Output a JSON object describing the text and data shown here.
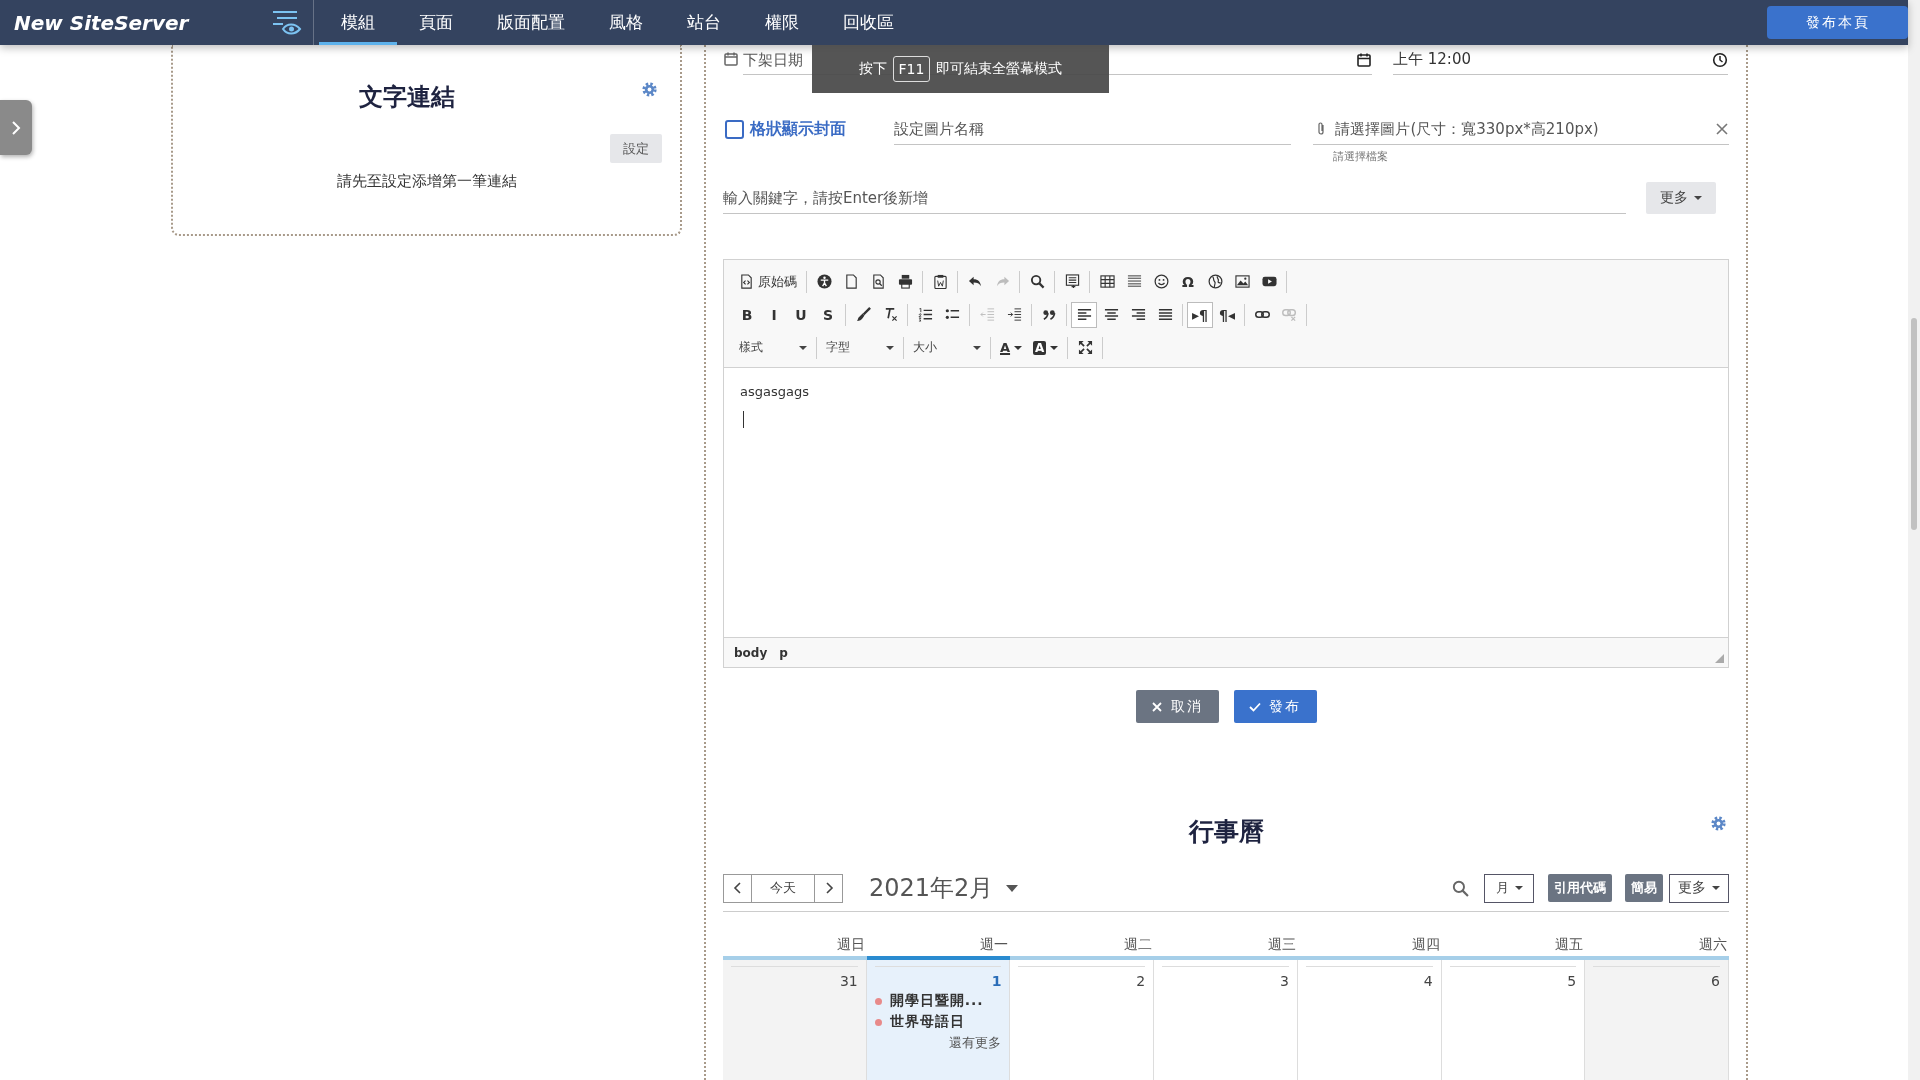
{
  "header": {
    "logo": "New SiteServer",
    "tabs": [
      {
        "label": "模組",
        "selected": true
      },
      {
        "label": "頁面",
        "selected": false
      },
      {
        "label": "版面配置",
        "selected": false
      },
      {
        "label": "風格",
        "selected": false
      },
      {
        "label": "站台",
        "selected": false
      },
      {
        "label": "權限",
        "selected": false
      },
      {
        "label": "回收區",
        "selected": false
      }
    ],
    "publish_button": "發布本頁"
  },
  "card": {
    "title": "文字連結",
    "settings_button": "設定",
    "message": "請先至設定添增第一筆連結"
  },
  "form": {
    "expire_date": {
      "placeholder": "下架日期"
    },
    "time": {
      "value": "上午 12:00"
    },
    "fullscreen_tip": {
      "before": "按下",
      "key": "F11",
      "after": "即可結束全螢幕模式"
    },
    "grid_cover": {
      "label": "格狀顯示封面",
      "checked": false
    },
    "image_name": {
      "placeholder": "設定圖片名稱"
    },
    "image_file": {
      "placeholder": "請選擇圖片(尺寸：寬330px*高210px)",
      "hint": "請選擇檔案"
    },
    "keywords": {
      "placeholder": "輸入關鍵字，請按Enter後新增"
    },
    "more_button": "更多"
  },
  "editor": {
    "rows": [
      {
        "groups": [
          {
            "items": [
              {
                "kind": "labeled",
                "label": "原始碼",
                "disabled": false,
                "active": false
              }
            ]
          },
          {
            "items": [
              {
                "kind": "icon",
                "disabled": false,
                "active": false
              },
              {
                "kind": "icon",
                "disabled": false,
                "active": false
              },
              {
                "kind": "icon",
                "disabled": false,
                "active": false
              },
              {
                "kind": "icon",
                "disabled": false,
                "active": false
              }
            ]
          },
          {
            "items": [
              {
                "kind": "icon",
                "disabled": false,
                "active": false
              }
            ]
          },
          {
            "items": [
              {
                "kind": "icon",
                "disabled": false,
                "active": false
              },
              {
                "kind": "icon",
                "disabled": true,
                "active": false
              }
            ]
          },
          {
            "items": [
              {
                "kind": "icon",
                "disabled": false,
                "active": false
              }
            ]
          },
          {
            "items": [
              {
                "kind": "icon",
                "disabled": false,
                "active": false
              }
            ]
          },
          {
            "items": [
              {
                "kind": "icon",
                "disabled": false,
                "active": false
              },
              {
                "kind": "icon",
                "disabled": false,
                "active": false
              },
              {
                "kind": "icon",
                "disabled": false,
                "active": false
              },
              {
                "kind": "glyph",
                "label": "Ω",
                "disabled": false,
                "active": false
              },
              {
                "kind": "icon",
                "disabled": false,
                "active": false
              },
              {
                "kind": "icon",
                "disabled": false,
                "active": false
              },
              {
                "kind": "icon",
                "disabled": false,
                "active": false
              }
            ]
          }
        ]
      },
      {
        "groups": [
          {
            "items": [
              {
                "kind": "glyph",
                "label": "B",
                "disabled": false,
                "active": false
              },
              {
                "kind": "glyph",
                "label": "I",
                "disabled": false,
                "active": false
              },
              {
                "kind": "glyph",
                "label": "U",
                "disabled": false,
                "active": false
              },
              {
                "kind": "glyph",
                "label": "S",
                "disabled": false,
                "active": false
              }
            ]
          },
          {
            "items": [
              {
                "kind": "icon",
                "disabled": false,
                "active": false
              },
              {
                "kind": "icon",
                "disabled": false,
                "active": false
              }
            ]
          },
          {
            "items": [
              {
                "kind": "icon",
                "disabled": false,
                "active": false
              },
              {
                "kind": "icon",
                "disabled": false,
                "active": false
              }
            ]
          },
          {
            "items": [
              {
                "kind": "icon",
                "disabled": true,
                "active": false
              },
              {
                "kind": "icon",
                "disabled": false,
                "active": false
              }
            ]
          },
          {
            "items": [
              {
                "kind": "icon",
                "disabled": false,
                "active": false
              }
            ]
          },
          {
            "items": [
              {
                "kind": "icon",
                "disabled": false,
                "active": true
              },
              {
                "kind": "icon",
                "disabled": false,
                "active": false
              },
              {
                "kind": "icon",
                "disabled": false,
                "active": false
              },
              {
                "kind": "icon",
                "disabled": false,
                "active": false
              }
            ]
          },
          {
            "items": [
              {
                "kind": "glyph",
                "label": "▸¶",
                "disabled": false,
                "active": true
              },
              {
                "kind": "glyph",
                "label": "¶◂",
                "disabled": false,
                "active": false
              }
            ]
          },
          {
            "items": [
              {
                "kind": "icon",
                "disabled": false,
                "active": false
              },
              {
                "kind": "icon",
                "disabled": true,
                "active": false
              }
            ]
          }
        ]
      },
      {
        "groups": [
          {
            "items": [
              {
                "kind": "dropdown",
                "label": "樣式",
                "disabled": false,
                "active": false
              }
            ]
          },
          {
            "items": [
              {
                "kind": "dropdown",
                "label": "字型",
                "disabled": false,
                "active": false
              }
            ]
          },
          {
            "items": [
              {
                "kind": "dropdown",
                "label": "大小",
                "disabled": false,
                "active": false
              }
            ]
          },
          {
            "items": [
              {
                "kind": "textcolor",
                "label": "A",
                "disabled": false,
                "active": false
              },
              {
                "kind": "bgcolor",
                "label": "A",
                "disabled": false,
                "active": false
              }
            ]
          },
          {
            "items": [
              {
                "kind": "icon",
                "disabled": false,
                "active": false
              }
            ]
          }
        ]
      }
    ],
    "content": [
      "asgasgags"
    ],
    "path": [
      "body",
      "p"
    ]
  },
  "actions": {
    "cancel": "取消",
    "publish": "發布"
  },
  "calendar": {
    "title": "行事曆",
    "today_button": "今天",
    "month": "2021年2月",
    "view_dropdown": "月",
    "embed_button": "引用代碼",
    "simple_button": "簡易",
    "more_button": "更多",
    "weekdays": [
      {
        "label": "週日",
        "today": false
      },
      {
        "label": "週一",
        "today": true
      },
      {
        "label": "週二",
        "today": false
      },
      {
        "label": "週三",
        "today": false
      },
      {
        "label": "週四",
        "today": false
      },
      {
        "label": "週五",
        "today": false
      },
      {
        "label": "週六",
        "today": false
      }
    ],
    "days": [
      {
        "number": "31",
        "today": false
      },
      {
        "number": "1",
        "today": true,
        "events": [
          {
            "title": "開學日暨開..."
          },
          {
            "title": "世界母語日"
          }
        ],
        "more": "還有更多"
      },
      {
        "number": "2",
        "today": false
      },
      {
        "number": "3",
        "today": false
      },
      {
        "number": "4",
        "today": false
      },
      {
        "number": "5",
        "today": false
      },
      {
        "number": "6",
        "today": false
      }
    ]
  }
}
